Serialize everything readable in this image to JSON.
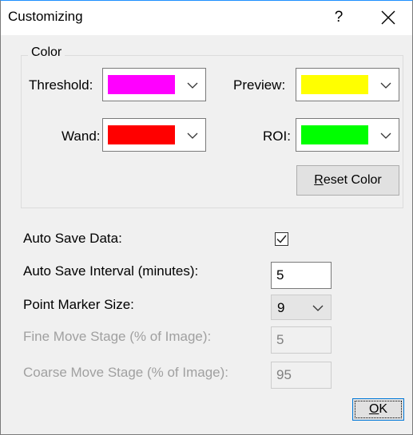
{
  "window": {
    "title": "Customizing",
    "help_label": "?",
    "close_label": "close"
  },
  "color_group": {
    "legend": "Color",
    "threshold": {
      "label": "Threshold:",
      "color": "#ff00ff"
    },
    "preview": {
      "label": "Preview:",
      "color": "#ffff00"
    },
    "wand": {
      "label": "Wand:",
      "color": "#ff0000"
    },
    "roi": {
      "label": "ROI:",
      "color": "#00ff00"
    },
    "reset_button": {
      "prefix": "",
      "mnemonic": "R",
      "rest": "eset Color"
    }
  },
  "settings": {
    "auto_save_data": {
      "label": "Auto Save Data:",
      "checked": true
    },
    "auto_save_interval": {
      "label": "Auto Save Interval (minutes):",
      "value": "5"
    },
    "point_marker_size": {
      "label": "Point Marker Size:",
      "value": "9"
    },
    "fine_move_stage": {
      "label": "Fine Move Stage (% of Image):",
      "value": "5"
    },
    "coarse_move_stage": {
      "label": "Coarse Move Stage (% of Image):",
      "value": "95"
    }
  },
  "ok_button": {
    "mnemonic": "O",
    "rest": "K"
  }
}
